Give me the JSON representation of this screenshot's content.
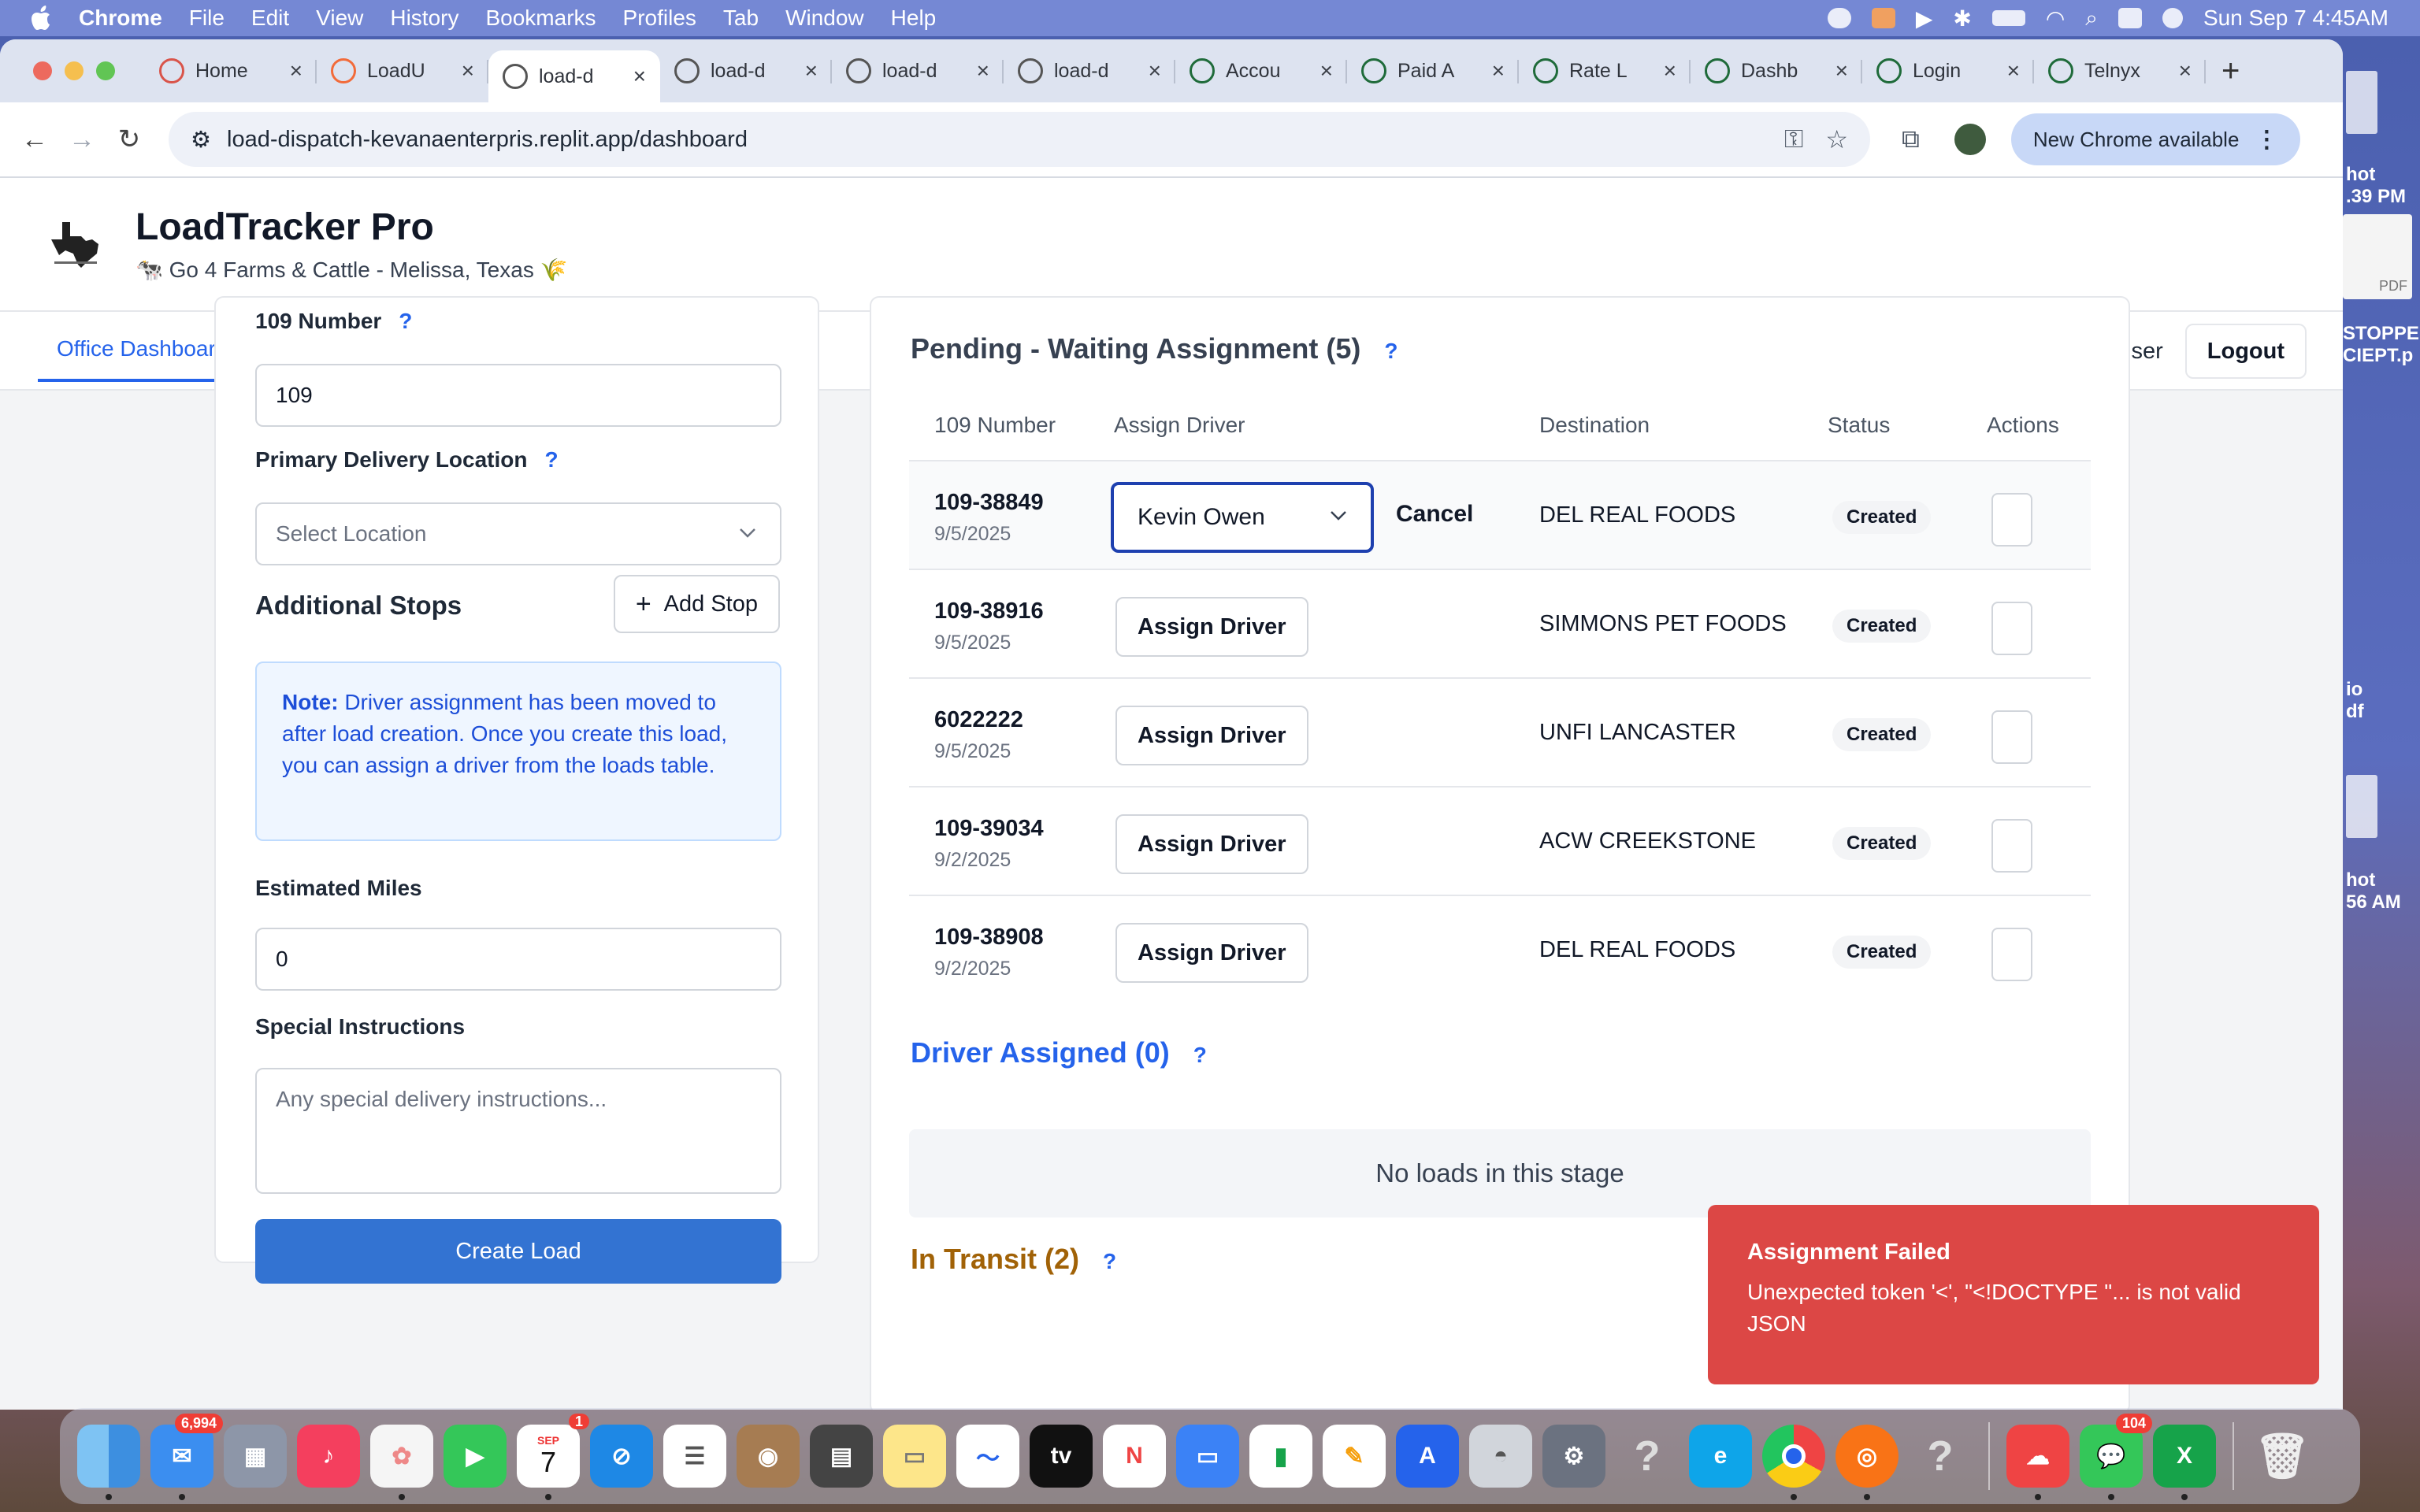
{
  "menubar": {
    "app": "Chrome",
    "items": [
      "File",
      "Edit",
      "View",
      "History",
      "Bookmarks",
      "Profiles",
      "Tab",
      "Window",
      "Help"
    ],
    "datetime": "Sun Sep 7  4:45AM"
  },
  "tabs": [
    {
      "label": "Home",
      "fav": "#d9544a",
      "active": false
    },
    {
      "label": "LoadU",
      "fav": "#f26b3a",
      "active": false
    },
    {
      "label": "load-d",
      "fav": "#555",
      "active": true
    },
    {
      "label": "load-d",
      "fav": "#555",
      "active": false
    },
    {
      "label": "load-d",
      "fav": "#555",
      "active": false
    },
    {
      "label": "load-d",
      "fav": "#555",
      "active": false
    },
    {
      "label": "Accou",
      "fav": "#1f6b3a",
      "active": false
    },
    {
      "label": "Paid A",
      "fav": "#1f6b3a",
      "active": false
    },
    {
      "label": "Rate L",
      "fav": "#1f6b3a",
      "active": false
    },
    {
      "label": "Dashb",
      "fav": "#1f6b3a",
      "active": false
    },
    {
      "label": "Login",
      "fav": "#1f6b3a",
      "active": false
    },
    {
      "label": "Telnyx",
      "fav": "#1f6b3a",
      "active": false
    }
  ],
  "address": {
    "url": "load-dispatch-kevanaenterpris.replit.app/dashboard",
    "new_chrome": "New Chrome available"
  },
  "app": {
    "title": "LoadTracker Pro",
    "subtitle": "🐄 Go 4 Farms & Cattle - Melissa, Texas 🌾",
    "nav_tab": "Office Dashboard",
    "user": "Admin User",
    "logout": "Logout"
  },
  "form": {
    "number_label": "109 Number",
    "number_value": "109",
    "location_label": "Primary Delivery Location",
    "location_placeholder": "Select Location",
    "stops_label": "Additional Stops",
    "add_stop": "Add Stop",
    "note_bold": "Note:",
    "note_text": " Driver assignment has been moved to after load creation. Once you create this load, you can assign a driver from the loads table.",
    "miles_label": "Estimated Miles",
    "miles_value": "0",
    "instructions_label": "Special Instructions",
    "instructions_placeholder": "Any special delivery instructions...",
    "create": "Create Load",
    "help": "?"
  },
  "pending": {
    "title": "Pending - Waiting Assignment (5)",
    "columns": [
      "109 Number",
      "Assign Driver",
      "Destination",
      "Status",
      "Actions"
    ],
    "rows": [
      {
        "number": "109-38849",
        "date": "9/5/2025",
        "destination": "DEL REAL FOODS",
        "status": "Created",
        "selected_driver": "Kevin Owen",
        "cancel": "Cancel"
      },
      {
        "number": "109-38916",
        "date": "9/5/2025",
        "destination": "SIMMONS PET FOODS",
        "status": "Created",
        "assign": "Assign Driver"
      },
      {
        "number": "6022222",
        "date": "9/5/2025",
        "destination": "UNFI LANCASTER",
        "status": "Created",
        "assign": "Assign Driver"
      },
      {
        "number": "109-39034",
        "date": "9/2/2025",
        "destination": "ACW CREEKSTONE",
        "status": "Created",
        "assign": "Assign Driver"
      },
      {
        "number": "109-38908",
        "date": "9/2/2025",
        "destination": "DEL REAL FOODS",
        "status": "Created",
        "assign": "Assign Driver"
      }
    ]
  },
  "assigned": {
    "title": "Driver Assigned (0)",
    "empty": "No loads in this stage"
  },
  "transit": {
    "title": "In Transit (2)"
  },
  "toast": {
    "title": "Assignment Failed",
    "message": "Unexpected token '<', \"<!DOCTYPE \"... is not valid JSON"
  },
  "desktop": {
    "label1a": "hot",
    "label1b": ".39 PM",
    "pdf": "PDF",
    "label2a": "STOPPE",
    "label2b": "CIEPT.p",
    "label3a": "io",
    "label3b": "df",
    "label4a": "hot",
    "label4b": "56 AM"
  },
  "dock": {
    "mail_badge": "6,994",
    "cal_month": "SEP",
    "cal_day": "7",
    "cal_badge": "1",
    "msg_badge": "104"
  }
}
